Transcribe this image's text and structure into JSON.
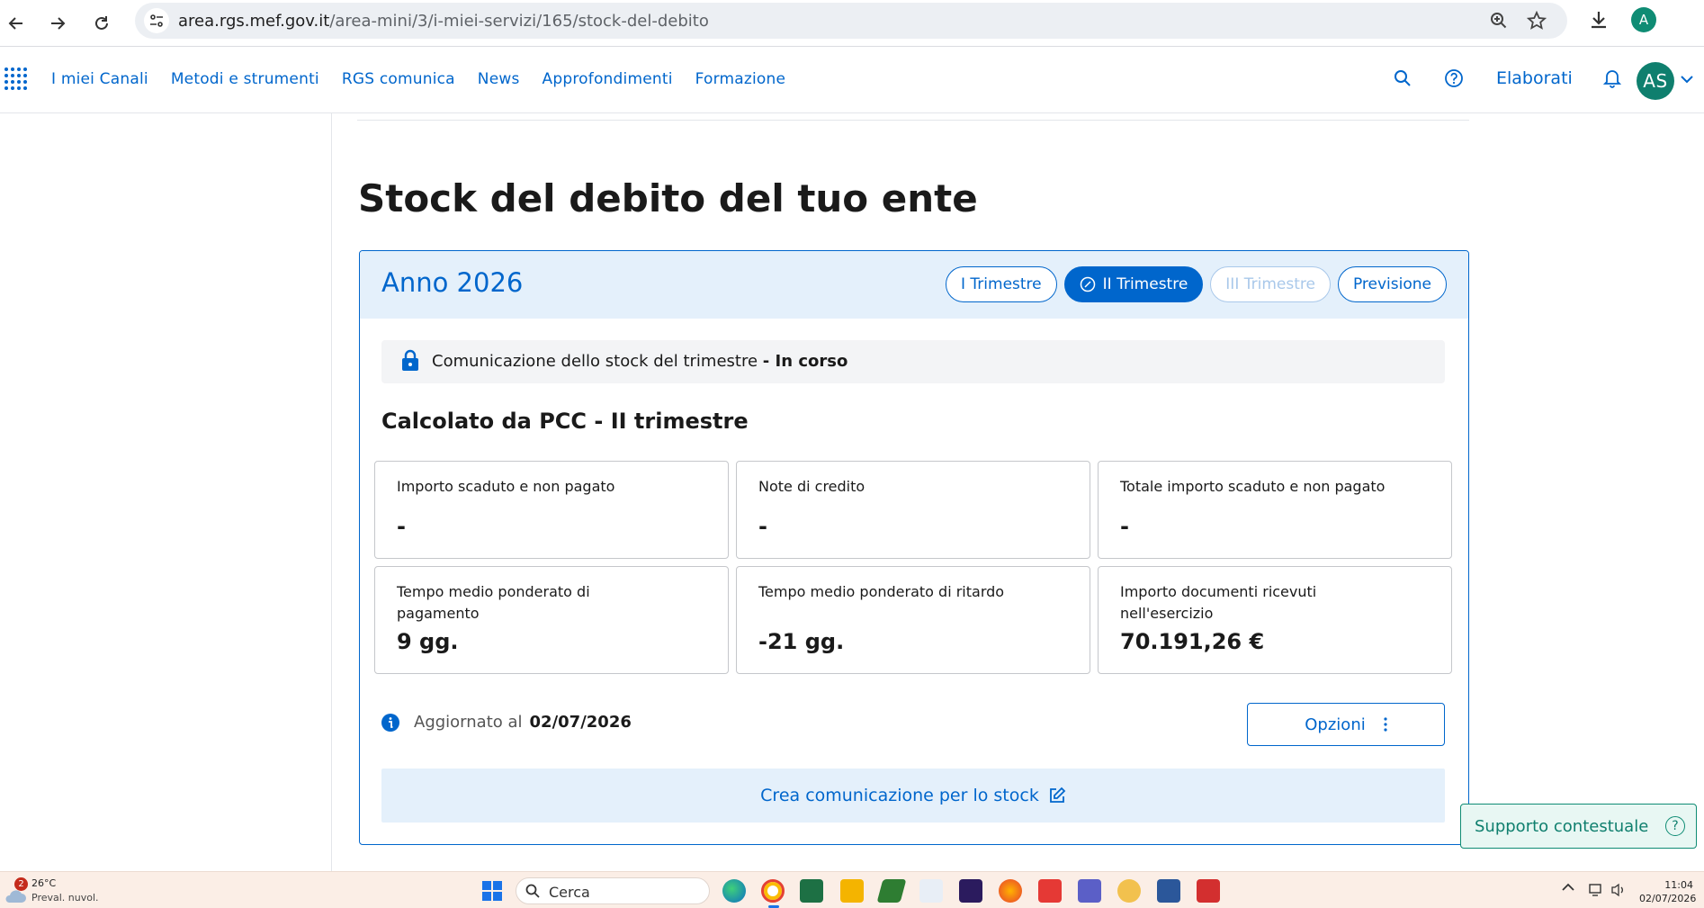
{
  "browser": {
    "url_host": "area.rgs.mef.gov.it",
    "url_path": "/area-mini/3/i-miei-servizi/165/stock-del-debito",
    "profile_initial": "A"
  },
  "header": {
    "nav": [
      "I miei Canali",
      "Metodi e strumenti",
      "RGS comunica",
      "News",
      "Approfondimenti",
      "Formazione"
    ],
    "elaborati": "Elaborati",
    "avatar_initials": "AS"
  },
  "page": {
    "title": "Stock del debito del tuo ente"
  },
  "card": {
    "year": "Anno 2026",
    "tabs": [
      {
        "label": "I Trimestre",
        "state": "normal"
      },
      {
        "label": "II Trimestre",
        "state": "active"
      },
      {
        "label": "III Trimestre",
        "state": "disabled"
      },
      {
        "label": "Previsione",
        "state": "normal"
      }
    ],
    "status": {
      "text": "Comunicazione dello stock del trimestre",
      "state": "- In corso"
    },
    "subtitle": "Calcolato da PCC - II trimestre",
    "metrics": [
      {
        "label": "Importo scaduto e non pagato",
        "value": "-"
      },
      {
        "label": "Note di credito",
        "value": "-"
      },
      {
        "label": "Totale importo scaduto e non pagato",
        "value": "-"
      },
      {
        "label": "Tempo medio ponderato di pagamento",
        "value": "9 gg."
      },
      {
        "label": "Tempo medio ponderato di ritardo",
        "value": "-21 gg."
      },
      {
        "label": "Importo documenti ricevuti nell'esercizio",
        "value": "70.191,26 €"
      }
    ],
    "updated_label": "Aggiornato al",
    "updated_date": "02/07/2026",
    "options_label": "Opzioni",
    "cta_label": "Crea comunicazione per lo stock"
  },
  "support_label": "Supporto contestuale",
  "taskbar": {
    "weather_badge": "2",
    "temperature": "26°C",
    "weather_desc": "Preval. nuvol.",
    "search_label": "Cerca",
    "time": "11:04",
    "date": "02/07/2026"
  },
  "colors": {
    "accent": "#0066cc",
    "card_header_bg": "#e4f0fb",
    "support_green": "#0f8c74"
  }
}
